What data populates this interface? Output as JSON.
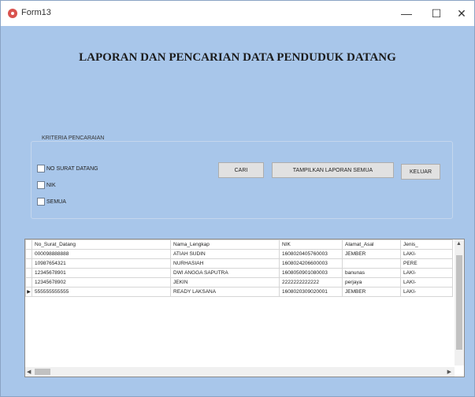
{
  "window": {
    "title": "Form13",
    "minimize": "—",
    "maximize": "☐",
    "close": "✕"
  },
  "header": {
    "title": "LAPORAN DAN PENCARIAN DATA PENDUDUK DATANG"
  },
  "criteria": {
    "label": "KRITERIA PENCARAIAN",
    "options": [
      "NO SURAT DATANG",
      "NIK",
      "SEMUA"
    ]
  },
  "buttons": {
    "cari": "CARI",
    "tampilkan": "TAMPILKAN LAPORAN SEMUA",
    "keluar": "KELUAR"
  },
  "grid": {
    "columns": [
      "No_Surat_Datang",
      "Nama_Lengkap",
      "NIK",
      "Alamat_Asal",
      "Jenis_"
    ],
    "rows": [
      [
        "000098888888",
        "ATIAH SUDIN",
        "1608020405760003",
        "JEMBER",
        "LAKI-"
      ],
      [
        "10987654321",
        "NURHASIAH",
        "1608024206600003",
        "",
        "PERE"
      ],
      [
        "12345678901",
        "DWI ANGGA SAPUTRA",
        "1608050901080003",
        "banunas",
        "LAKI-"
      ],
      [
        "12345678902",
        "JEKIN",
        "2222222222222",
        "perjaya",
        "LAKI-"
      ],
      [
        "555555555555",
        "READY LAKSANA",
        "1608020309020001",
        "JEMBER",
        "LAKI-"
      ]
    ],
    "current_row_marker": "▶",
    "scroll_up": "▲",
    "scroll_left": "◀",
    "scroll_right": "▶"
  }
}
